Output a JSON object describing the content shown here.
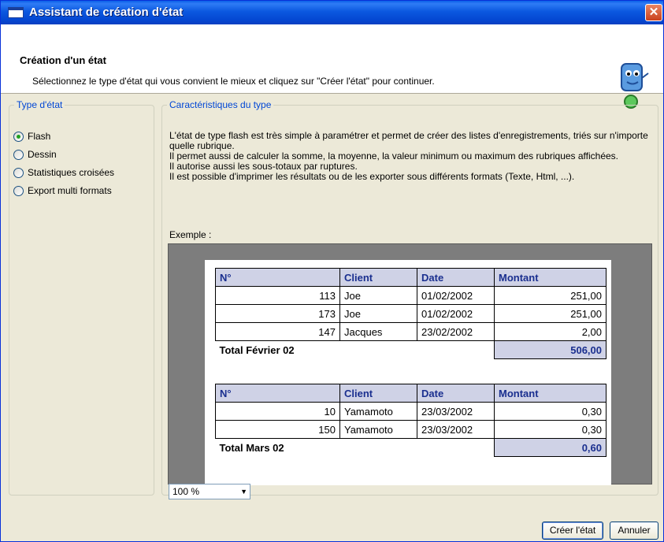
{
  "window": {
    "title": "Assistant de création d'état",
    "close_label": "✕"
  },
  "header": {
    "title": "Création d'un état",
    "subtitle": "Sélectionnez le type d'état qui vous convient le mieux et cliquez sur \"Créer l'état\" pour continuer."
  },
  "type_panel": {
    "legend": "Type d'état",
    "options": [
      {
        "label": "Flash",
        "checked": true
      },
      {
        "label": "Dessin",
        "checked": false
      },
      {
        "label": "Statistiques croisées",
        "checked": false
      },
      {
        "label": "Export multi formats",
        "checked": false
      }
    ]
  },
  "characteristics": {
    "legend": "Caractéristiques du type",
    "lines": [
      "L'état de type flash est très simple à paramétrer et permet de créer des listes d'enregistrements, triés sur n'importe quelle rubrique.",
      "Il permet aussi de calculer la somme, la moyenne, la valeur minimum ou maximum des rubriques affichées.",
      "Il autorise aussi les sous-totaux par ruptures.",
      "Il est possible d'imprimer les résultats ou de les exporter sous différents formats (Texte, Html, ...)."
    ],
    "example_label": "Exemple :"
  },
  "example": {
    "columns": [
      "N°",
      "Client",
      "Date",
      "Montant"
    ],
    "groups": [
      {
        "rows": [
          [
            "113",
            "Joe",
            "01/02/2002",
            "251,00"
          ],
          [
            "173",
            "Joe",
            "01/02/2002",
            "251,00"
          ],
          [
            "147",
            "Jacques",
            "23/02/2002",
            "2,00"
          ]
        ],
        "total_label": "Total Février 02",
        "total_value": "506,00"
      },
      {
        "rows": [
          [
            "10",
            "Yamamoto",
            "23/03/2002",
            "0,30"
          ],
          [
            "150",
            "Yamamoto",
            "23/03/2002",
            "0,30"
          ]
        ],
        "total_label": "Total Mars 02",
        "total_value": "0,60"
      }
    ]
  },
  "zoom": {
    "value": "100 %"
  },
  "buttons": {
    "create": "Créer l'état",
    "cancel": "Annuler"
  }
}
